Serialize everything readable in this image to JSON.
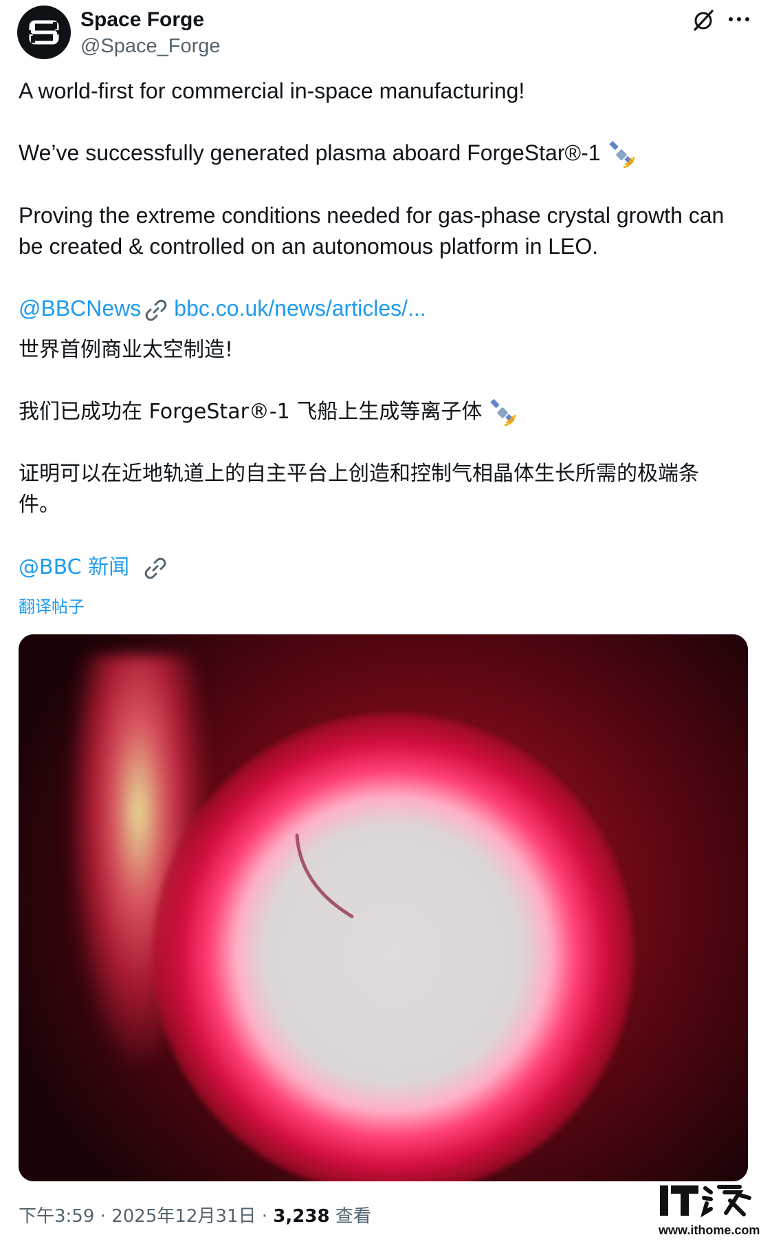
{
  "post": {
    "author": {
      "display_name": "Space Forge",
      "handle": "@Space_Forge",
      "avatar_icon": "space-forge-s-logo-icon"
    },
    "header_icons": [
      "grok-icon",
      "more-options-icon"
    ],
    "text_en": {
      "line1": "A world-first for commercial in-space manufacturing!",
      "line2": "We’ve successfully generated plasma aboard ForgeStar®-1",
      "line3": "Proving the extreme conditions needed for gas-phase crystal growth can",
      "line4": "be created & controlled on an autonomous platform in LEO.",
      "mention": "@BBCNews",
      "url": "bbc.co.uk/news/articles/..."
    },
    "text_zh": {
      "line1": "世界首例商业太空制造!",
      "line2": "我们已成功在 ForgeStar®-1 飞船上生成等离子体",
      "line3": "证明可以在近地轨道上的自主平台上创造和控制气相晶体生长所需的极端条",
      "line4": "件。",
      "mention": "@BBC 新闻"
    },
    "emoji": "satellite-icon",
    "translate_label": "翻译帖子",
    "footer": {
      "time": "下午3:59",
      "sep1": "·",
      "date": "2025年12月31日",
      "sep2": "·",
      "views_count": "3,238",
      "views_label": "查看"
    }
  },
  "watermark": {
    "url": "www.ithome.com"
  },
  "colors": {
    "link": "#1d9bf0",
    "secondary_text": "#536471",
    "primary_text": "#0f1419"
  }
}
